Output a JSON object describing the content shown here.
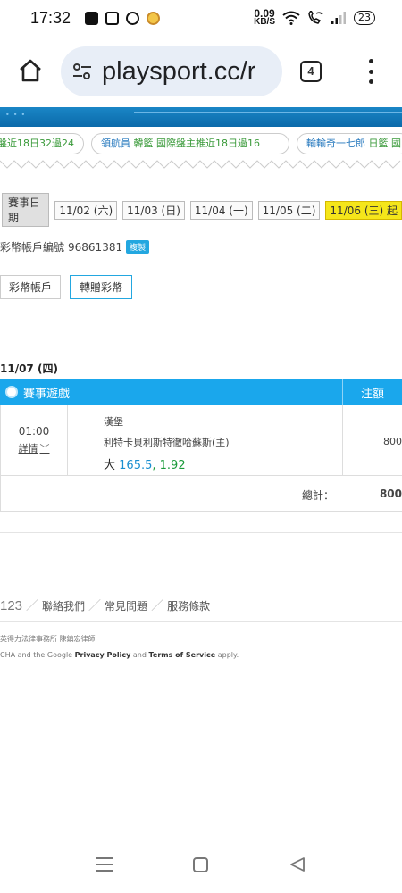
{
  "status": {
    "time": "17:32",
    "net_speed_value": "0.09",
    "net_speed_unit": "KB/S",
    "battery": "23",
    "icons": [
      "facebook-icon",
      "instagram-icon",
      "threads-icon",
      "app-icon",
      "wifi-icon",
      "wifi-call-icon",
      "signal-icon",
      "battery-icon"
    ]
  },
  "browser": {
    "url": "playsport.cc/r",
    "tab_count": "4",
    "icons": [
      "home-icon",
      "site-settings-icon",
      "tabs-icon",
      "more-menu-icon"
    ]
  },
  "ticker": [
    {
      "prefix": "",
      "text": "盤近18日32過24"
    },
    {
      "prefix": "領航員 ",
      "name": "韓籃",
      "text": " 國際盤主推近18日過16"
    },
    {
      "prefix": "輸輸奇一七郎 ",
      "name": "日籃",
      "text": " 國"
    }
  ],
  "date_filter": {
    "label": "賽事日期",
    "dates": [
      "11/02 (六)",
      "11/03 (日)",
      "11/04 (一)",
      "11/05 (二)"
    ],
    "active": "11/06 (三) 起"
  },
  "account": {
    "label": "彩幣帳戶編號",
    "number": "96861381",
    "copy_label": "複製"
  },
  "buttons": {
    "wallet": "彩幣帳戶",
    "gift": "轉贈彩幣"
  },
  "orders": {
    "date": "11/07 (四)",
    "col_game": "賽事遊戲",
    "col_amount": "注額",
    "rows": [
      {
        "time": "01:00",
        "detail": "詳情",
        "team_home": "漢堡",
        "team_away": "利特卡貝利斯特徹哈蘇斯(主)",
        "pick_side": "大",
        "pick_line": "165.5",
        "pick_odds": "1.92",
        "amount": "800"
      }
    ],
    "total_label": "總計：",
    "total_value": "800"
  },
  "footer": {
    "number": "123",
    "links": [
      "聯絡我們",
      "常見問題",
      "服務條款"
    ],
    "law": "英得力法律事務所 陳鎮宏律師",
    "recaptcha_prefix": "CHA and the Google ",
    "privacy": "Privacy Policy",
    "and": " and ",
    "terms": "Terms of Service",
    "suffix": " apply."
  }
}
